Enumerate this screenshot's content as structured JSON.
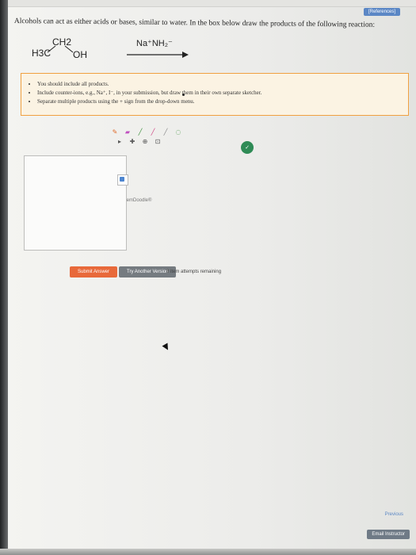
{
  "header": {
    "references_label": "[References]"
  },
  "question": {
    "text": "Alcohols can act as either acids or bases, similar to water. In the box below draw the products of the following reaction:"
  },
  "reaction": {
    "h3c": "H3C",
    "ch2": "CH2",
    "oh": "OH",
    "reagent": "Na⁺NH₂⁻"
  },
  "instructions": {
    "items": [
      "You should include all products.",
      "Include counter-ions, e.g., Na⁺, I⁻, in your submission, but draw them in their own separate sketcher.",
      "Separate multiple products using the + sign from the drop-down menu."
    ]
  },
  "editor": {
    "brand": "ChemDoodle®",
    "top_row_icons": [
      "pencil-icon",
      "eraser-icon",
      "pencil-icon",
      "pencil-icon",
      "pencil-icon",
      "ring-icon",
      "ring-icon",
      "dropdown-icon"
    ],
    "middle_row_icons": [
      "text-icon",
      "lasso-icon",
      "zoom-icon",
      "fit-icon"
    ],
    "bottom_row_icons": [
      "single-bond-icon",
      "double-bond-icon",
      "triple-bond-icon",
      "wedge-icon",
      "dash-icon",
      "benzene-icon",
      "cyclohexane-icon",
      "cyclopentane-icon",
      "more-icon"
    ],
    "bottom_label": "1.0"
  },
  "actions": {
    "submit_label": "Submit Answer",
    "try_label": "Try Another Version",
    "attempts_text": "8 item attempts remaining"
  },
  "footer": {
    "previous_label": "Previous",
    "email_label": "Email Instructor"
  },
  "colors": {
    "accent_blue": "#5b87c5",
    "submit_orange": "#e8693a",
    "instruction_border": "#f0a040",
    "ok_green": "#2f8b56"
  }
}
